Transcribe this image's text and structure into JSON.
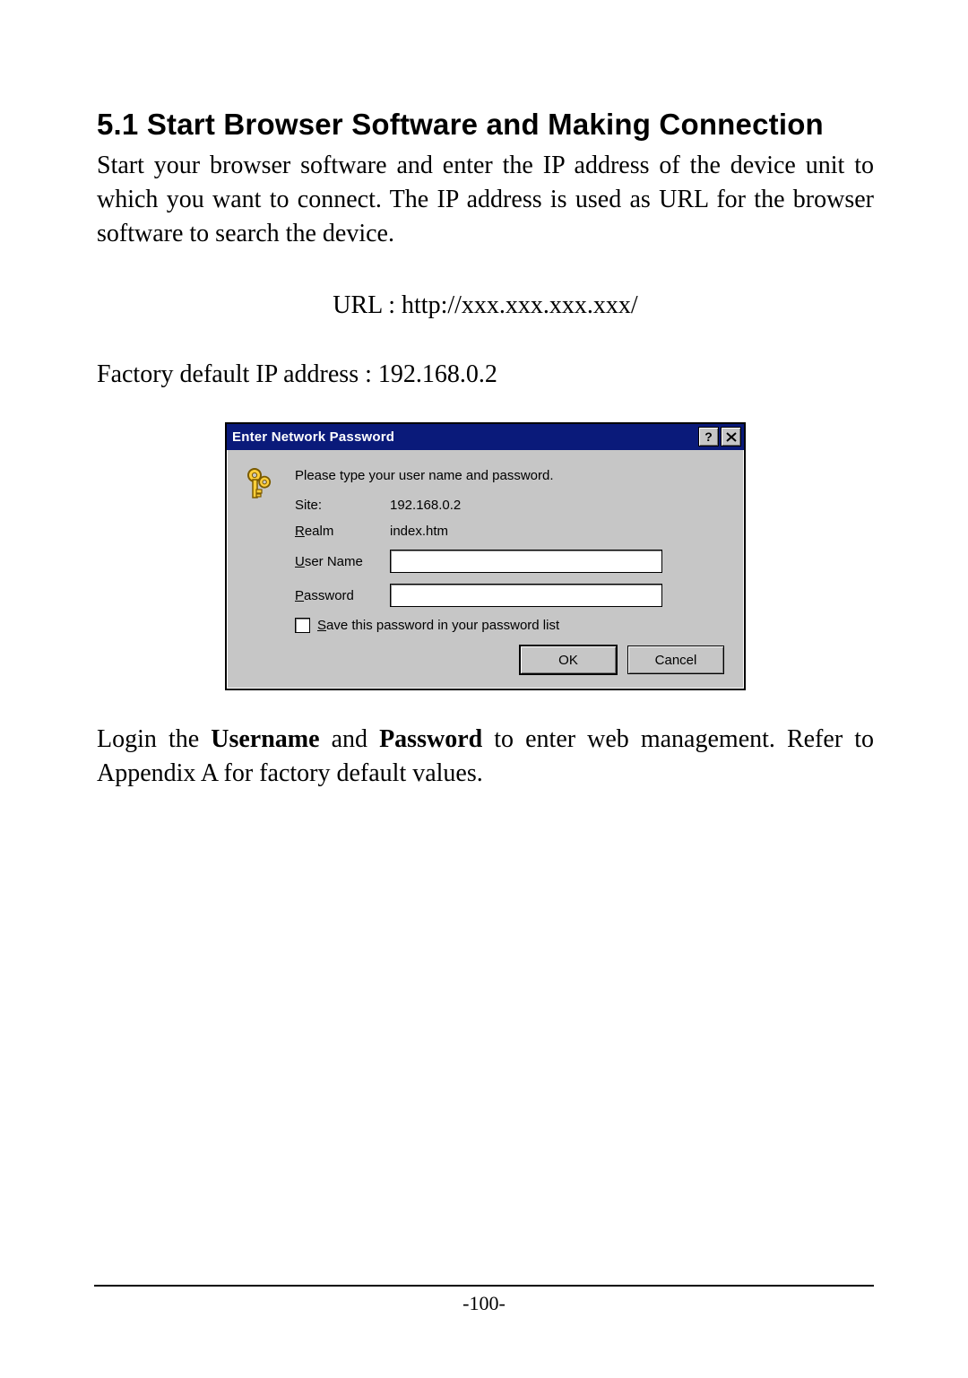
{
  "section": {
    "heading": "5.1 Start Browser Software and Making Connection",
    "para1": "Start your browser software and enter the IP address of the device unit to which you want to connect. The IP address is used as URL for the browser software to search the device.",
    "url_line": "URL : http://xxx.xxx.xxx.xxx/",
    "para2": "Factory default IP address : 192.168.0.2",
    "login_prefix": "Login the ",
    "login_b1": "Username",
    "login_mid": " and ",
    "login_b2": "Password",
    "login_suffix": " to enter web management. Refer to Appendix A for factory default values."
  },
  "dialog": {
    "title": "Enter Network Password",
    "help_btn": "?",
    "instruction": "Please type your user name and password.",
    "site_label": "Site:",
    "site_value": "192.168.0.2",
    "realm_label_pre_u": "R",
    "realm_label_rest": "ealm",
    "realm_value": "index.htm",
    "user_label_u": "U",
    "user_label_rest": "ser Name",
    "user_value": "",
    "pass_label_u": "P",
    "pass_label_rest": "assword",
    "pass_value": "",
    "save_label_u": "S",
    "save_label_rest": "ave this password in your password list",
    "ok": "OK",
    "cancel": "Cancel"
  },
  "footer": {
    "page": "-100-"
  }
}
